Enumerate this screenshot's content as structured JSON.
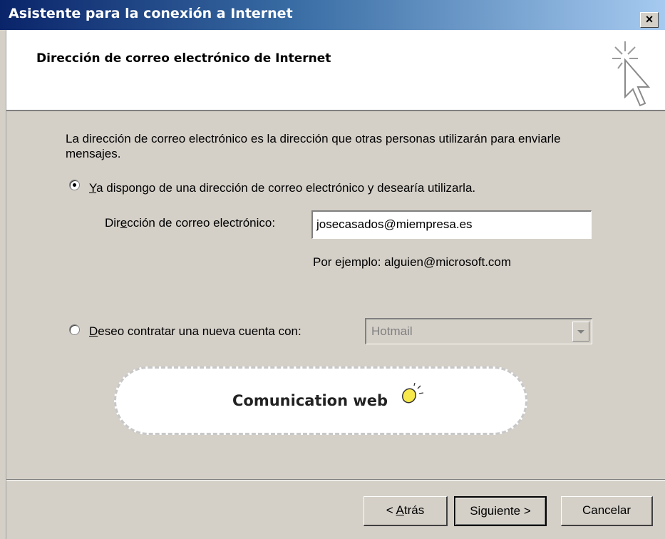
{
  "window": {
    "title": "Asistente para la conexión a Internet",
    "close_label": "×"
  },
  "header": {
    "title": "Dirección de correo electrónico de Internet",
    "icon": "wizard-cursor-icon"
  },
  "description": "La dirección de correo electrónico es la dirección que otras personas utilizarán para enviarle mensajes.",
  "option_existing": {
    "label_first": "Y",
    "label_rest": "a dispongo de una dirección de correo electrónico y desearía utilizarla.",
    "selected": true
  },
  "email": {
    "label_before": "Dir",
    "label_accel": "e",
    "label_after": "cción de correo electrónico:",
    "value": "josecasados@miempresa.es",
    "example": "Por ejemplo: alguien@microsoft.com"
  },
  "option_new": {
    "label_first": "D",
    "label_rest": "eseo contratar una nueva cuenta con:",
    "selected": false,
    "provider": "Hotmail"
  },
  "banner": {
    "text": "Comunication web"
  },
  "buttons": {
    "back_prefix": "< ",
    "back_accel": "A",
    "back_rest": "trás",
    "next_label": "Siguiente >",
    "cancel_label": "Cancelar"
  },
  "colors": {
    "title_start": "#0a246a",
    "title_end": "#a6caf0",
    "dialog_bg": "#d4d0c8",
    "bulb": "#f7e84b"
  }
}
